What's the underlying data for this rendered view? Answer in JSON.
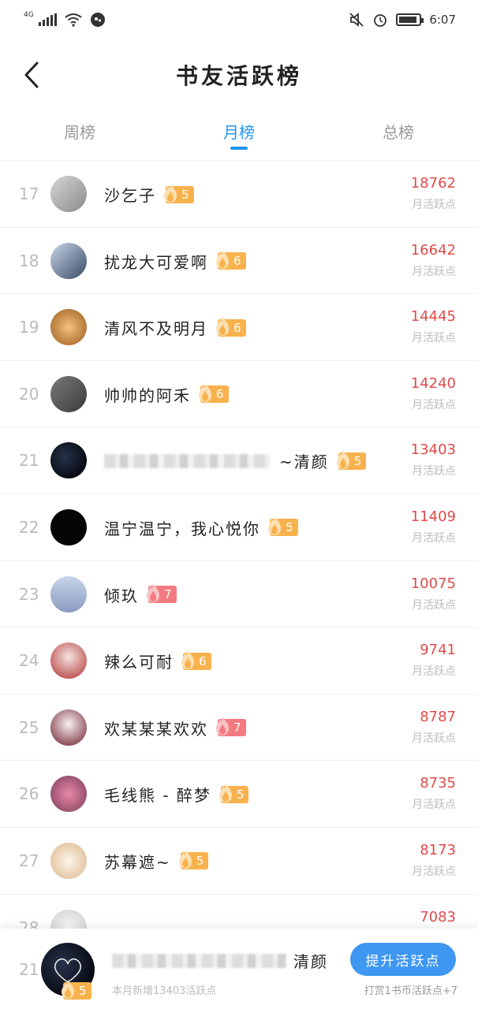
{
  "status_bar": {
    "network": "4G",
    "time": "6:07"
  },
  "header": {
    "title": "书友活跃榜"
  },
  "tabs": [
    {
      "label": "周榜",
      "active": false
    },
    {
      "label": "月榜",
      "active": true
    },
    {
      "label": "总榜",
      "active": false
    }
  ],
  "points_label": "月活跃点",
  "rows": [
    {
      "rank": "17",
      "name": "沙乞子",
      "level": "5",
      "points": "18762",
      "badge_color": "orange"
    },
    {
      "rank": "18",
      "name": "扰龙大可爱啊",
      "level": "6",
      "points": "16642",
      "badge_color": "orange"
    },
    {
      "rank": "19",
      "name": "清风不及明月",
      "level": "6",
      "points": "14445",
      "badge_color": "orange"
    },
    {
      "rank": "20",
      "name": "帅帅的阿禾",
      "level": "6",
      "points": "14240",
      "badge_color": "orange"
    },
    {
      "rank": "21",
      "name": "~清颜",
      "level": "5",
      "points": "13403",
      "badge_color": "orange",
      "blurred_prefix": true
    },
    {
      "rank": "22",
      "name": "温宁温宁，我心悦你",
      "level": "5",
      "points": "11409",
      "badge_color": "orange"
    },
    {
      "rank": "23",
      "name": "倾玖",
      "level": "7",
      "points": "10075",
      "badge_color": "red"
    },
    {
      "rank": "24",
      "name": "辣么可耐",
      "level": "6",
      "points": "9741",
      "badge_color": "orange"
    },
    {
      "rank": "25",
      "name": "欢某某某欢欢",
      "level": "7",
      "points": "8787",
      "badge_color": "red"
    },
    {
      "rank": "26",
      "name": "毛线熊 - 醉梦",
      "level": "5",
      "points": "8735",
      "badge_color": "orange"
    },
    {
      "rank": "27",
      "name": "苏幕遮~",
      "level": "5",
      "points": "8173",
      "badge_color": "orange"
    },
    {
      "rank": "28",
      "name": "",
      "level": "",
      "points": "7083",
      "badge_color": "orange"
    }
  ],
  "bottom": {
    "rank": "21",
    "name": "清颜",
    "level": "5",
    "subtitle": "本月新增13403活跃点",
    "boost_button": "提升活跃点",
    "reward_text": "打赏1书币活跃点+7"
  },
  "colors": {
    "accent": "#2196f3",
    "points": "#e14a4a",
    "badge_orange": "#f8b24d",
    "badge_red": "#f37a80"
  }
}
